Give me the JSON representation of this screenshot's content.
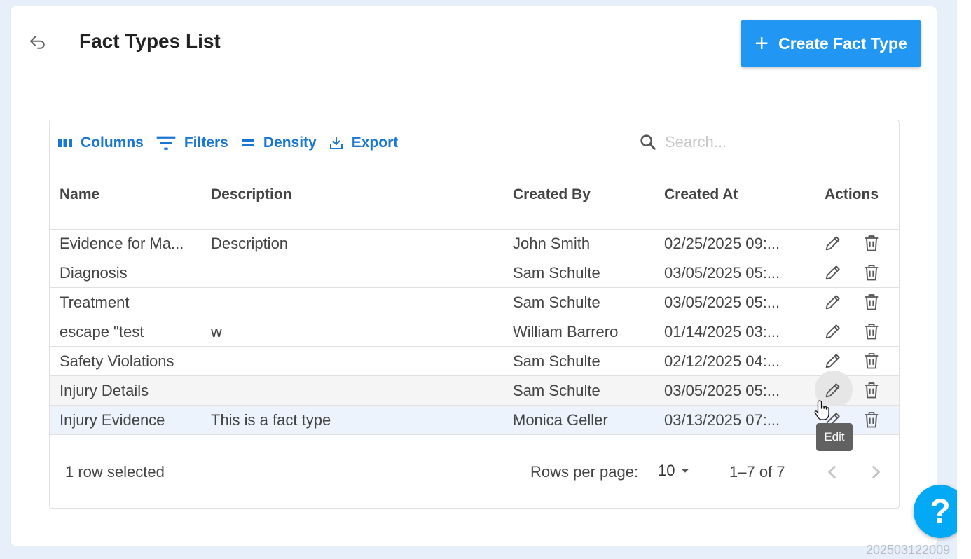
{
  "header": {
    "title": "Fact Types List",
    "create_label": "Create Fact Type"
  },
  "toolbar": {
    "columns": "Columns",
    "filters": "Filters",
    "density": "Density",
    "export": "Export"
  },
  "search": {
    "placeholder": "Search..."
  },
  "table": {
    "headers": [
      "Name",
      "Description",
      "Created By",
      "Created At",
      "Actions"
    ],
    "rows": [
      {
        "name": "Evidence for Ma...",
        "description": "Description",
        "created_by": "John Smith",
        "created_at": "02/25/2025 09:..."
      },
      {
        "name": "Diagnosis",
        "description": "",
        "created_by": "Sam Schulte",
        "created_at": "03/05/2025 05:..."
      },
      {
        "name": "Treatment",
        "description": "",
        "created_by": "Sam Schulte",
        "created_at": "03/05/2025 05:..."
      },
      {
        "name": "escape \"test",
        "description": "w",
        "created_by": "William Barrero",
        "created_at": "01/14/2025 03:..."
      },
      {
        "name": "Safety Violations",
        "description": "",
        "created_by": "Sam Schulte",
        "created_at": "02/12/2025 04:..."
      },
      {
        "name": "Injury Details",
        "description": "",
        "created_by": "Sam Schulte",
        "created_at": "03/05/2025 05:..."
      },
      {
        "name": "Injury Evidence",
        "description": "This is a fact type",
        "created_by": "Monica Geller",
        "created_at": "03/13/2025 07:..."
      }
    ]
  },
  "footer": {
    "selected": "1 row selected",
    "rows_per_page_label": "Rows per page:",
    "rows_per_page_value": "10",
    "range": "1–7 of 7"
  },
  "tooltip": "Edit",
  "help": "?",
  "build_id": "202503122009",
  "colors": {
    "primary": "#2196f3",
    "help": "#03a9f4",
    "selected_row": "#ecf3fc"
  }
}
